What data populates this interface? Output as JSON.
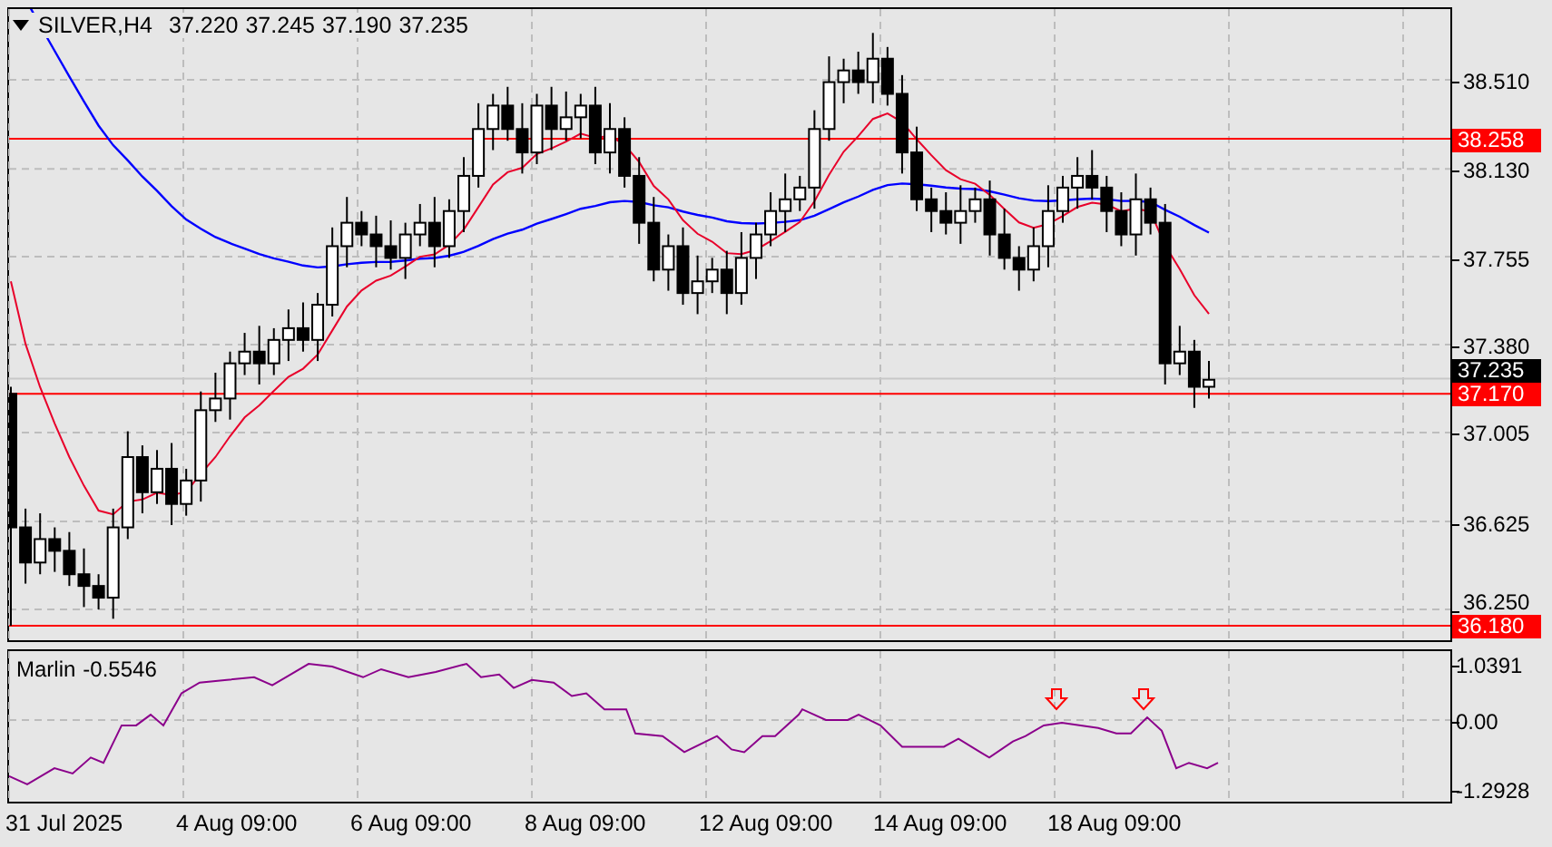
{
  "chart": {
    "symbol": "SILVER,H4",
    "ohlc": [
      "37.220",
      "37.245",
      "37.190",
      "37.235"
    ],
    "price_axis": [
      "38.510",
      "38.130",
      "37.755",
      "37.380",
      "37.005",
      "36.625",
      "36.250"
    ],
    "price_tags": [
      {
        "text": "38.258",
        "color": "#ff0000"
      },
      {
        "text": "37.235",
        "color": "#000000"
      },
      {
        "text": "37.170",
        "color": "#ff0000"
      },
      {
        "text": "36.180",
        "color": "#ff0000"
      }
    ]
  },
  "indicator": {
    "name": "Marlin",
    "value": "-0.5546",
    "axis": [
      "1.0391",
      "0.00",
      "-1.2928"
    ]
  },
  "time_axis": [
    "31 Jul 2025",
    "4 Aug 09:00",
    "6 Aug 09:00",
    "8 Aug 09:00",
    "12 Aug 09:00",
    "14 Aug 09:00",
    "18 Aug 09:00"
  ]
}
